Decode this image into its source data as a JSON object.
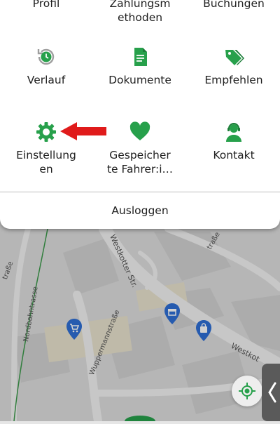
{
  "menu": {
    "row1": [
      {
        "label": "Profil"
      },
      {
        "label_line1": "Zahlungsm",
        "label_line2": "ethoden"
      },
      {
        "label": "Buchungen"
      }
    ],
    "row2": [
      {
        "label": "Verlauf",
        "icon": "history-clock-icon"
      },
      {
        "label": "Dokumente",
        "icon": "document-icon"
      },
      {
        "label": "Empfehlen",
        "icon": "tag-icon"
      }
    ],
    "row3": [
      {
        "label_line1": "Einstellung",
        "label_line2": "en",
        "icon": "gear-icon"
      },
      {
        "label_line1": "Gespeicher",
        "label_line2": "te Fahrer:i…",
        "icon": "heart-icon"
      },
      {
        "label": "Kontakt",
        "icon": "support-agent-icon"
      }
    ],
    "logout": "Ausloggen"
  },
  "map": {
    "streets": [
      "Westkotter Str.",
      "Westkot",
      "Wuppermannstraße",
      "Nordbahntrasse",
      "traße",
      "traße"
    ]
  },
  "colors": {
    "green": "#27a04b",
    "arrow": "#e01b1b",
    "pin": "#2f6fd6"
  }
}
